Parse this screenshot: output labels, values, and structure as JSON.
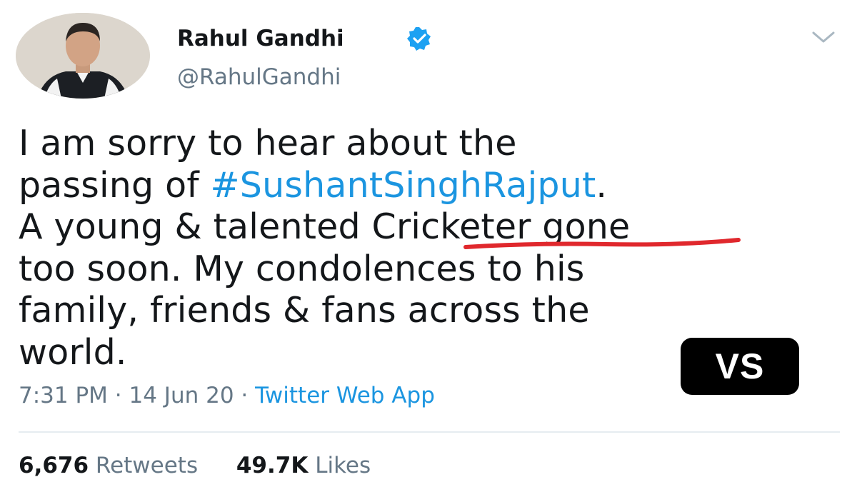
{
  "tweet": {
    "author": {
      "display_name": "Rahul Gandhi",
      "handle": "@RahulGandhi",
      "verified": true
    },
    "text_lines": [
      {
        "before": "I am sorry to hear about the",
        "hashtag": "",
        "after": ""
      },
      {
        "before": "passing of ",
        "hashtag": "#SushantSinghRajput",
        "after": "."
      },
      {
        "before": "A young & talented Cricketer gone",
        "hashtag": "",
        "after": ""
      },
      {
        "before": "too soon. My condolences to his",
        "hashtag": "",
        "after": ""
      },
      {
        "before": "family, friends & fans across the",
        "hashtag": "",
        "after": ""
      },
      {
        "before": "world.",
        "hashtag": "",
        "after": ""
      }
    ],
    "timestamp": "7:31 PM",
    "date": "14 Jun 20",
    "source": "Twitter Web App",
    "retweets_count": "6,676",
    "retweets_label": "Retweets",
    "likes_count": "49.7K",
    "likes_label": "Likes"
  },
  "overlay": {
    "badge_text": "VS",
    "underline_color": "#e0282d"
  },
  "colors": {
    "link": "#1b95e0",
    "secondary_text": "#657786",
    "primary_text": "#14171a",
    "verified_badge": "#1da1f2"
  },
  "icons": [
    "verified-badge-icon",
    "chevron-down-icon"
  ]
}
